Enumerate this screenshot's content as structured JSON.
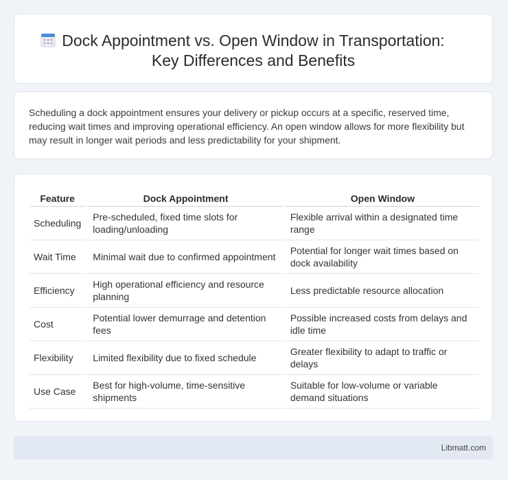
{
  "header": {
    "icon": "calendar-icon",
    "title": "Dock Appointment vs. Open Window in Transportation: Key Differences and Benefits"
  },
  "intro": "Scheduling a dock appointment ensures your delivery or pickup occurs at a specific, reserved time, reducing wait times and improving operational efficiency. An open window allows for more flexibility but may result in longer wait periods and less predictability for your shipment.",
  "table": {
    "headers": [
      "Feature",
      "Dock Appointment",
      "Open Window"
    ],
    "rows": [
      [
        "Scheduling",
        "Pre-scheduled, fixed time slots for loading/unloading",
        "Flexible arrival within a designated time range"
      ],
      [
        "Wait Time",
        "Minimal wait due to confirmed appointment",
        "Potential for longer wait times based on dock availability"
      ],
      [
        "Efficiency",
        "High operational efficiency and resource planning",
        "Less predictable resource allocation"
      ],
      [
        "Cost",
        "Potential lower demurrage and detention fees",
        "Possible increased costs from delays and idle time"
      ],
      [
        "Flexibility",
        "Limited flexibility due to fixed schedule",
        "Greater flexibility to adapt to traffic or delays"
      ],
      [
        "Use Case",
        "Best for high-volume, time-sensitive shipments",
        "Suitable for low-volume or variable demand situations"
      ]
    ]
  },
  "footer": {
    "site": "Libmatt.com"
  },
  "colors": {
    "background": "#f0f3f8",
    "card": "#ffffff",
    "footer": "#e3e9f3",
    "icon_accent": "#4a90d9"
  }
}
